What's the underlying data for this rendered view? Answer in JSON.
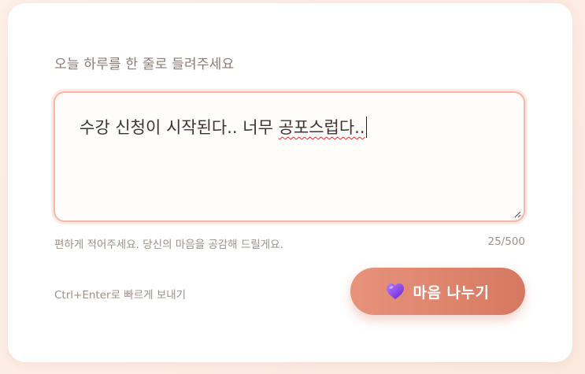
{
  "form": {
    "prompt": "오늘 하루를 한 줄로 들려주세요",
    "text_plain": "수강 신청이 시작된다.. 너무 ",
    "text_misspelled": "공포스럽다..",
    "hint": "편하게 적어주세요. 당신의 마음을 공감해 드릴게요.",
    "counter": "25/500",
    "shortcut": "Ctrl+Enter로 빠르게 보내기"
  },
  "button": {
    "label": "마음 나누기",
    "icon": "purple-heart-icon"
  },
  "colors": {
    "accent_start": "#e8937c",
    "accent_end": "#d67861",
    "textarea_border": "#f3b8a6",
    "heart": "#8a3df0"
  }
}
